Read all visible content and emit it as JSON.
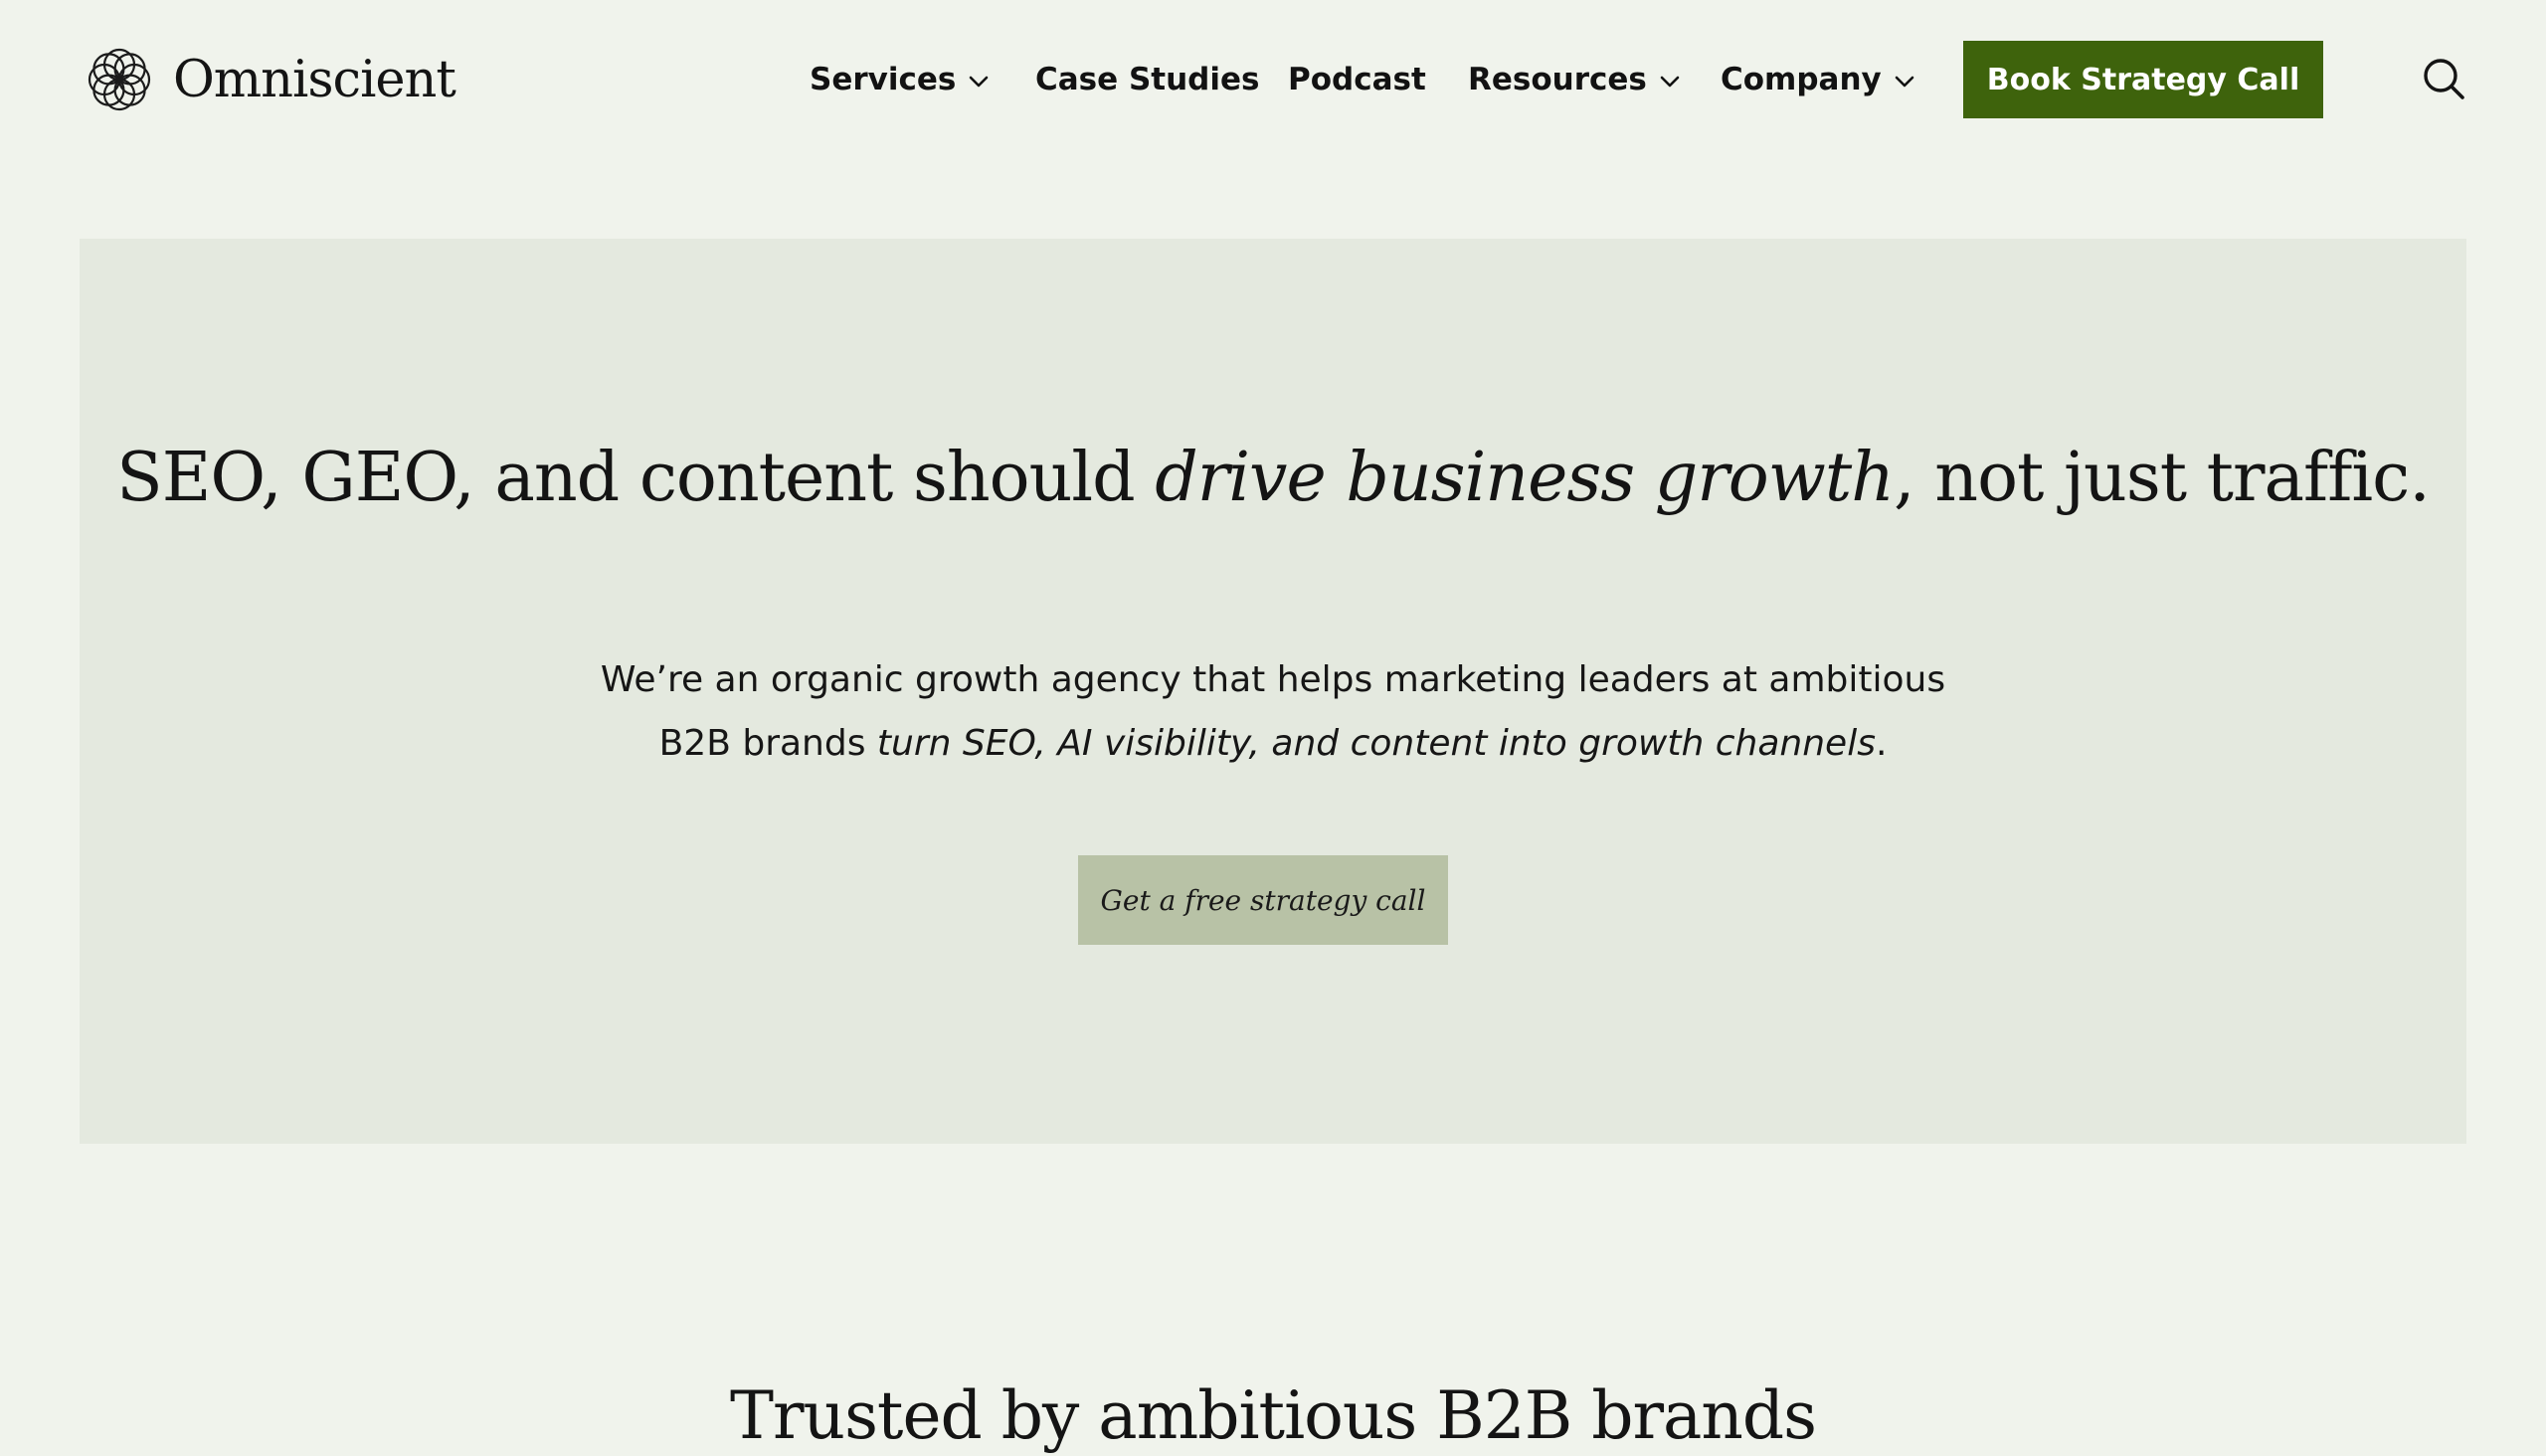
{
  "brand": {
    "name": "Omniscient",
    "logo_icon": "knot-logo-icon"
  },
  "nav": {
    "items": [
      {
        "label": "Services",
        "has_dropdown": true
      },
      {
        "label": "Case Studies",
        "has_dropdown": false
      },
      {
        "label": "Podcast",
        "has_dropdown": false
      },
      {
        "label": "Resources",
        "has_dropdown": true
      },
      {
        "label": "Company",
        "has_dropdown": true
      }
    ],
    "cta_label": "Book Strategy Call",
    "search_icon": "search-icon"
  },
  "hero": {
    "title_part1": "SEO, GEO, and content should ",
    "title_emphasis": "drive business growth",
    "title_part2": ", not just traffic.",
    "subtitle_part1": "We’re an organic growth agency that helps marketing leaders at ambitious B2B brands ",
    "subtitle_emphasis": "turn SEO, AI visibility, and content into growth channels",
    "subtitle_part2": ".",
    "button_label": "Get a free strategy call"
  },
  "trusted": {
    "heading": "Trusted by ambitious B2B brands"
  },
  "colors": {
    "page_background": "#f0f3ec",
    "hero_background": "#e4e9df",
    "cta_green": "#3e630c",
    "hero_button": "#b8c2a6",
    "text": "#141414"
  }
}
